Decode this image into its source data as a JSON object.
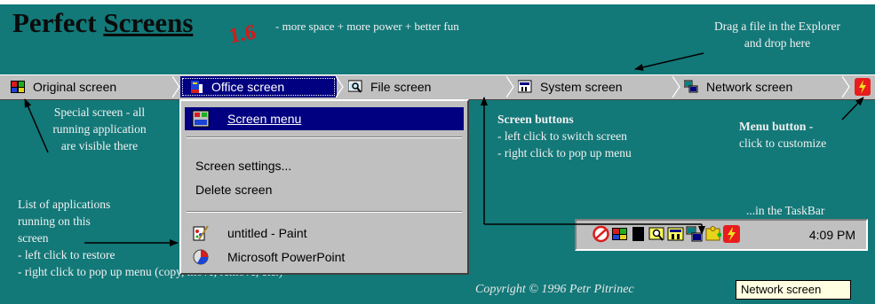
{
  "header": {
    "brand_part1": "Perfect ",
    "brand_part2": "Screens",
    "version": "1.6",
    "tagline": "- more space + more power + better fun"
  },
  "notes": {
    "drag_line1": "Drag a file in the Explorer",
    "drag_line2": "and drop here",
    "special_line1": "Special screen - all",
    "special_line2": "running application",
    "special_line3": "are visible there",
    "screen_buttons_title": "Screen buttons",
    "screen_buttons_line1": "- left click to switch screen",
    "screen_buttons_line2": "- right click to pop up menu",
    "menubutton_title": "Menu button -",
    "menubutton_line1": "click to customize",
    "apps_line1": "List of applications",
    "apps_line2": "running on this",
    "apps_line3": "screen",
    "apps_line4": "- left click to restore",
    "apps_line5": "- right click to pop up menu (copy, move, remove, etc.)",
    "taskbar_note": "...in the TaskBar",
    "copyright": "Copyright © 1996 Petr Pitrinec"
  },
  "tabs": {
    "original": "Original screen",
    "office": "Office screen",
    "file": "File screen",
    "system": "System screen",
    "network": "Network screen"
  },
  "menu": {
    "screen_menu": "Screen menu",
    "screen_settings": "Screen settings...",
    "delete_screen": "Delete screen",
    "app1": "untitled - Paint",
    "app2": "Microsoft PowerPoint"
  },
  "tray": {
    "clock": "4:09 PM"
  },
  "tooltip": {
    "text": "Network screen"
  },
  "colors": {
    "background": "#137878",
    "taskbar": "#c0c0c0",
    "selection": "#000080",
    "version_red": "#d41a1a",
    "tooltip_bg": "#ffffe1"
  },
  "icons": [
    "original-screen-icon",
    "office-screen-icon",
    "file-screen-icon",
    "system-screen-icon",
    "network-screen-icon",
    "menu-button-icon",
    "paint-icon",
    "powerpoint-icon",
    "screen-menu-icon"
  ]
}
